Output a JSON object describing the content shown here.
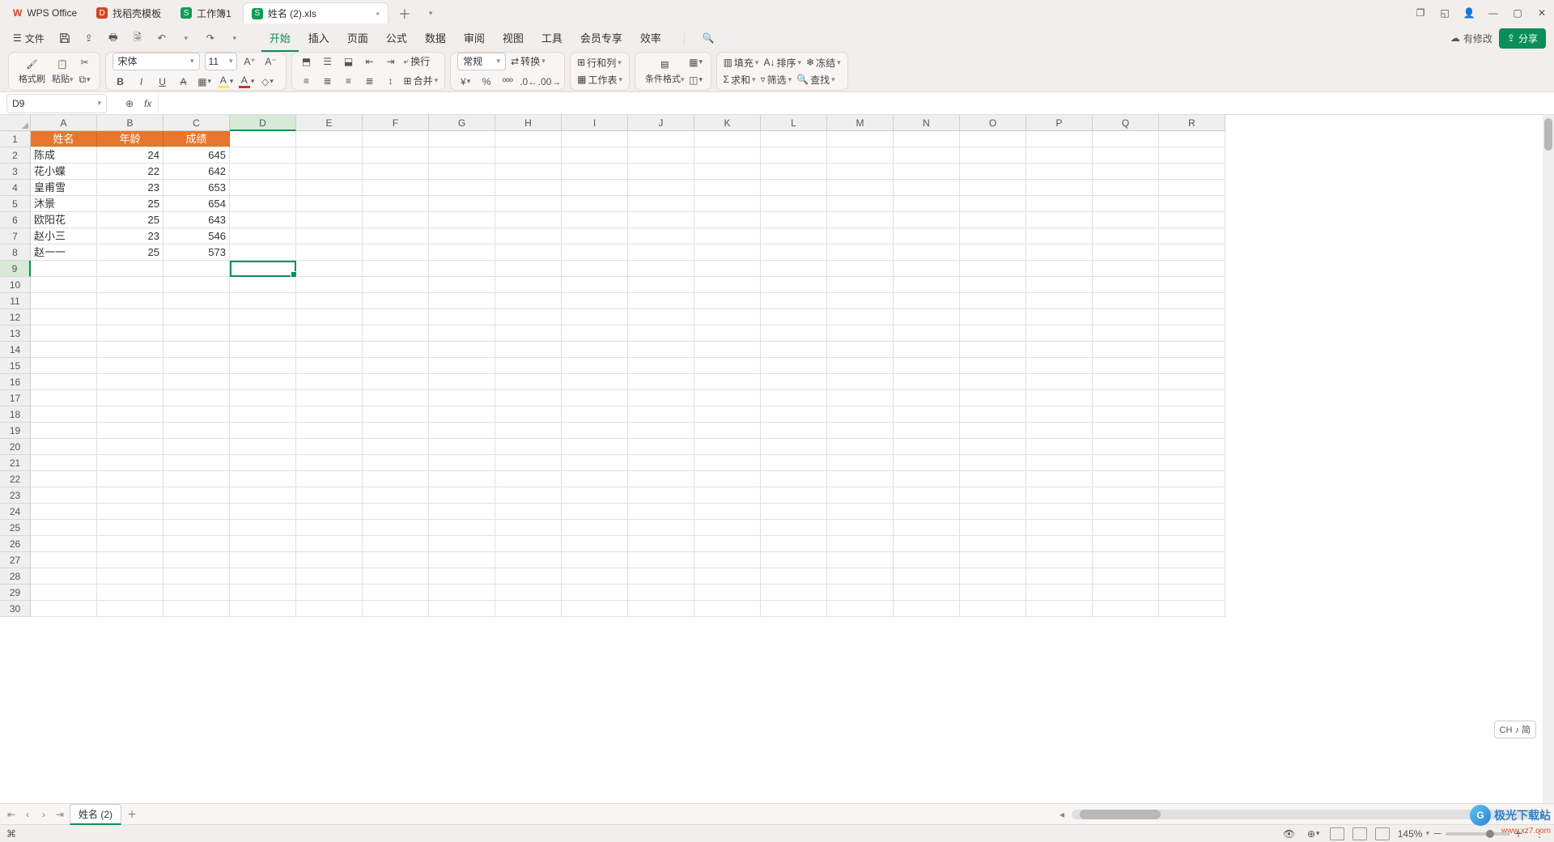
{
  "titlebar": {
    "app_name": "WPS Office",
    "tab_template": "找稻壳模板",
    "tab_workbook1": "工作簿1",
    "tab_current": "姓名 (2).xls",
    "modified_dot": "•"
  },
  "qat": {
    "file_menu": "文件",
    "has_changes": "有修改",
    "share": "分享"
  },
  "menu": {
    "start": "开始",
    "insert": "插入",
    "page": "页面",
    "formula": "公式",
    "data": "数据",
    "review": "审阅",
    "view": "视图",
    "tools": "工具",
    "member": "会员专享",
    "efficiency": "效率"
  },
  "ribbon": {
    "format_brush": "格式刷",
    "paste": "粘贴",
    "font_name": "宋体",
    "font_size": "11",
    "wrap": "换行",
    "merge": "合并",
    "numfmt": "常规",
    "convert": "转换",
    "rowcol": "行和列",
    "worksheet": "工作表",
    "cond_fmt": "条件格式",
    "fill": "填充",
    "sort": "排序",
    "freeze": "冻结",
    "sum": "求和",
    "filter": "筛选",
    "find": "查找"
  },
  "namebox": {
    "cell": "D9"
  },
  "columns": [
    "A",
    "B",
    "C",
    "D",
    "E",
    "F",
    "G",
    "H",
    "I",
    "J",
    "K",
    "L",
    "M",
    "N",
    "O",
    "P",
    "Q",
    "R"
  ],
  "headers": {
    "name": "姓名",
    "age": "年龄",
    "score": "成绩"
  },
  "rows": [
    {
      "name": "陈成",
      "age": 24,
      "score": 645
    },
    {
      "name": "花小蝶",
      "age": 22,
      "score": 642
    },
    {
      "name": "皇甫雪",
      "age": 23,
      "score": 653
    },
    {
      "name": "沐景",
      "age": 25,
      "score": 654
    },
    {
      "name": "欧阳花",
      "age": 25,
      "score": 643
    },
    {
      "name": "赵小三",
      "age": 23,
      "score": 546
    },
    {
      "name": "赵一一",
      "age": 25,
      "score": 573
    }
  ],
  "sheet_tab": "姓名 (2)",
  "ime": "CH ♪ 简",
  "zoom": "145%",
  "watermark": {
    "text": "极光下载站",
    "url": "www.xz7.com"
  }
}
